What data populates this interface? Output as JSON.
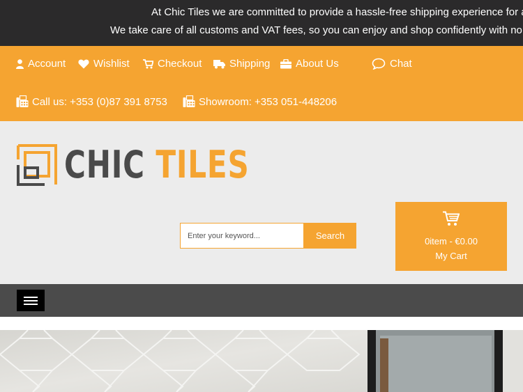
{
  "announcement": {
    "line1": "At Chic Tiles we are committed to provide a hassle-free shipping experience for all",
    "line2": "We take care of all customs and VAT fees, so you can enjoy and shop confidently with no additional"
  },
  "topnav": {
    "account": "Account",
    "wishlist": "Wishlist",
    "checkout": "Checkout",
    "shipping": "Shipping",
    "about": "About Us",
    "chat": "Chat"
  },
  "contact": {
    "phone": "Call us: +353 (0)87 391 8753",
    "showroom": "Showroom: +353 051-448206"
  },
  "logo": {
    "word1": "CHIC",
    "word2": "TILES"
  },
  "search": {
    "placeholder": "Enter your keyword...",
    "button": "Search"
  },
  "cart": {
    "count": "0item - €0.00",
    "label": "My Cart"
  },
  "colors": {
    "accent": "#f5a431",
    "dark": "#2b2a2b",
    "menubar": "#4b4b4b",
    "header_bg": "#ececec"
  }
}
